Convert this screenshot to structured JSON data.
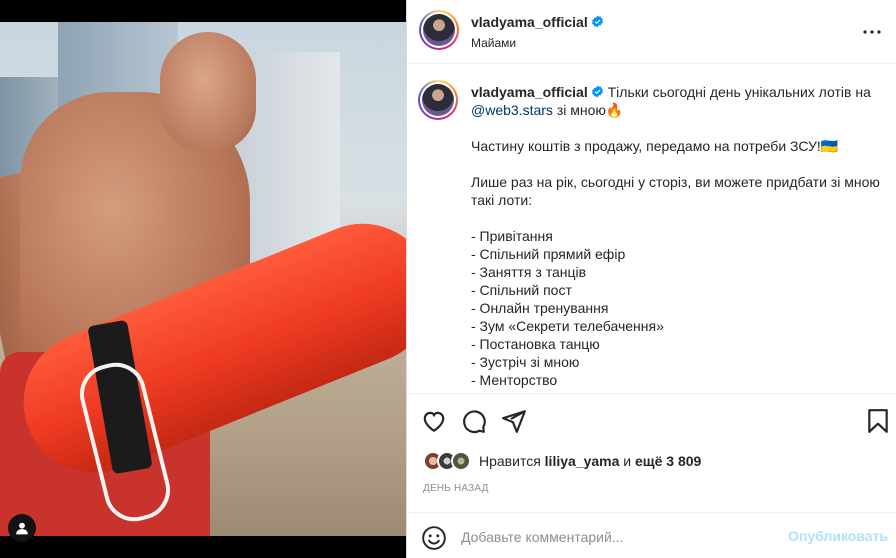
{
  "post": {
    "username": "vladyama_official",
    "location": "Майами",
    "mention": "@web3.stars",
    "caption_intro": "Тільки сьогодні день унікальних лотів на",
    "caption_intro_tail": "зі мною🔥",
    "paragraph2": "Частину коштів з продажу, передамо на потреби ЗСУ!🇺🇦",
    "paragraph3": "Лише раз на рік, сьогодні у сторіз, ви можете придбати зі мною такі лоти:",
    "list": [
      "- Привітання",
      "- Спільний прямий ефір",
      "- Заняття з танців",
      "- Спільний пост",
      "- Онлайн тренування",
      "- Зум «Секрети телебачення»",
      "- Постановка танцю",
      "- Зустріч зі мною",
      "- Менторство"
    ]
  },
  "likes": {
    "prefix": "Нравится",
    "user": "liliya_yama",
    "middle": "и",
    "others": "ещё 3 809"
  },
  "timestamp": "ДЕНЬ НАЗАД",
  "comment": {
    "placeholder": "Добавьте комментарий...",
    "publish_label": "Опубликовать"
  },
  "colors": {
    "verified": "#0095f6",
    "link": "#00376b",
    "publish": "#b2dffc"
  }
}
